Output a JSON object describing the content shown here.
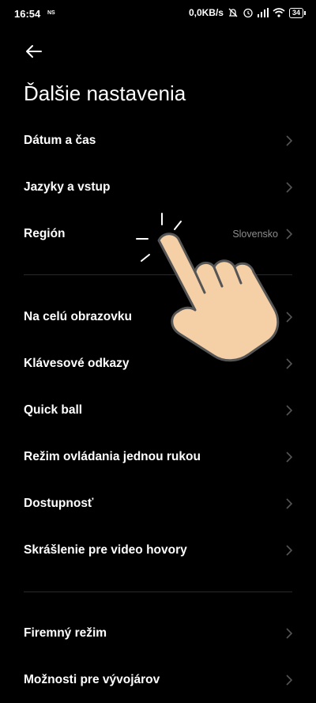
{
  "status": {
    "time": "16:54",
    "ns_badge": "NS",
    "network_speed": "0,0KB/s",
    "battery": "34"
  },
  "page": {
    "title": "Ďalšie nastavenia"
  },
  "groups": [
    {
      "items": [
        {
          "label": "Dátum a čas",
          "value": ""
        },
        {
          "label": "Jazyky a vstup",
          "value": ""
        },
        {
          "label": "Región",
          "value": "Slovensko"
        }
      ]
    },
    {
      "items": [
        {
          "label": "Na celú obrazovku",
          "value": ""
        },
        {
          "label": "Klávesové odkazy",
          "value": ""
        },
        {
          "label": "Quick ball",
          "value": ""
        },
        {
          "label": "Režim ovládania jednou rukou",
          "value": ""
        },
        {
          "label": "Dostupnosť",
          "value": ""
        },
        {
          "label": "Skrášlenie pre video hovory",
          "value": ""
        }
      ]
    },
    {
      "items": [
        {
          "label": "Firemný režim",
          "value": ""
        },
        {
          "label": "Možnosti pre vývojárov",
          "value": ""
        }
      ]
    }
  ],
  "icons": {
    "back": "back-arrow-icon",
    "chevron": "chevron-right-icon",
    "pointer": "tap-hand-icon"
  }
}
